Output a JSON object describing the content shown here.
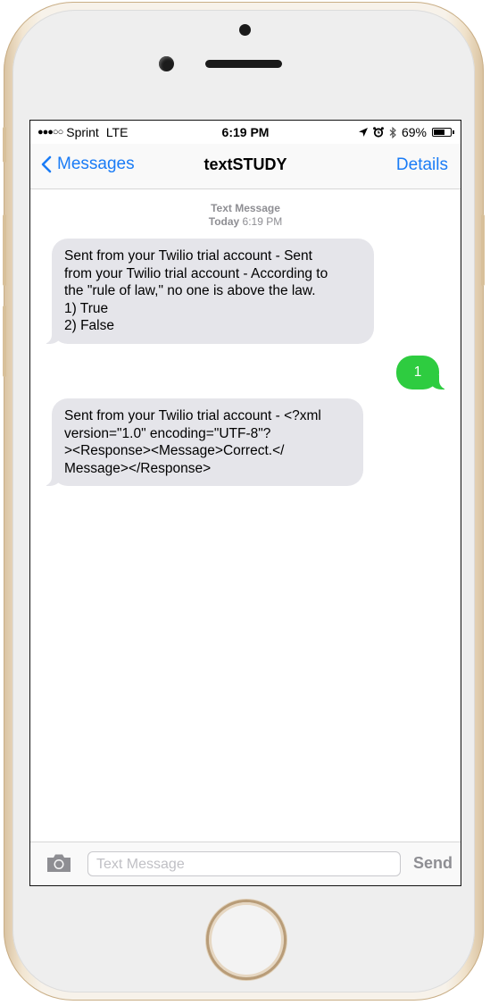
{
  "status_bar": {
    "signal": "●●●○○",
    "carrier": "Sprint",
    "network": "LTE",
    "time": "6:19 PM",
    "battery": "69%",
    "battery_level": 0.69
  },
  "nav": {
    "back_label": "Messages",
    "title": "textSTUDY",
    "details_label": "Details"
  },
  "conversation": {
    "header_type": "Text Message",
    "header_day": "Today",
    "header_time": "6:19 PM",
    "messages": [
      {
        "direction": "incoming",
        "text": "Sent from your Twilio trial account - Sent\nfrom your Twilio trial account - According to\nthe \"rule of law,\" no one is above the law.\n1) True\n2) False"
      },
      {
        "direction": "outgoing",
        "text": "1"
      },
      {
        "direction": "incoming",
        "text": "Sent from your Twilio trial account - <?xml\nversion=\"1.0\" encoding=\"UTF-8\"?\n><Response><Message>Correct.</\nMessage></Response>"
      }
    ]
  },
  "composer": {
    "placeholder": "Text Message",
    "send_label": "Send"
  }
}
